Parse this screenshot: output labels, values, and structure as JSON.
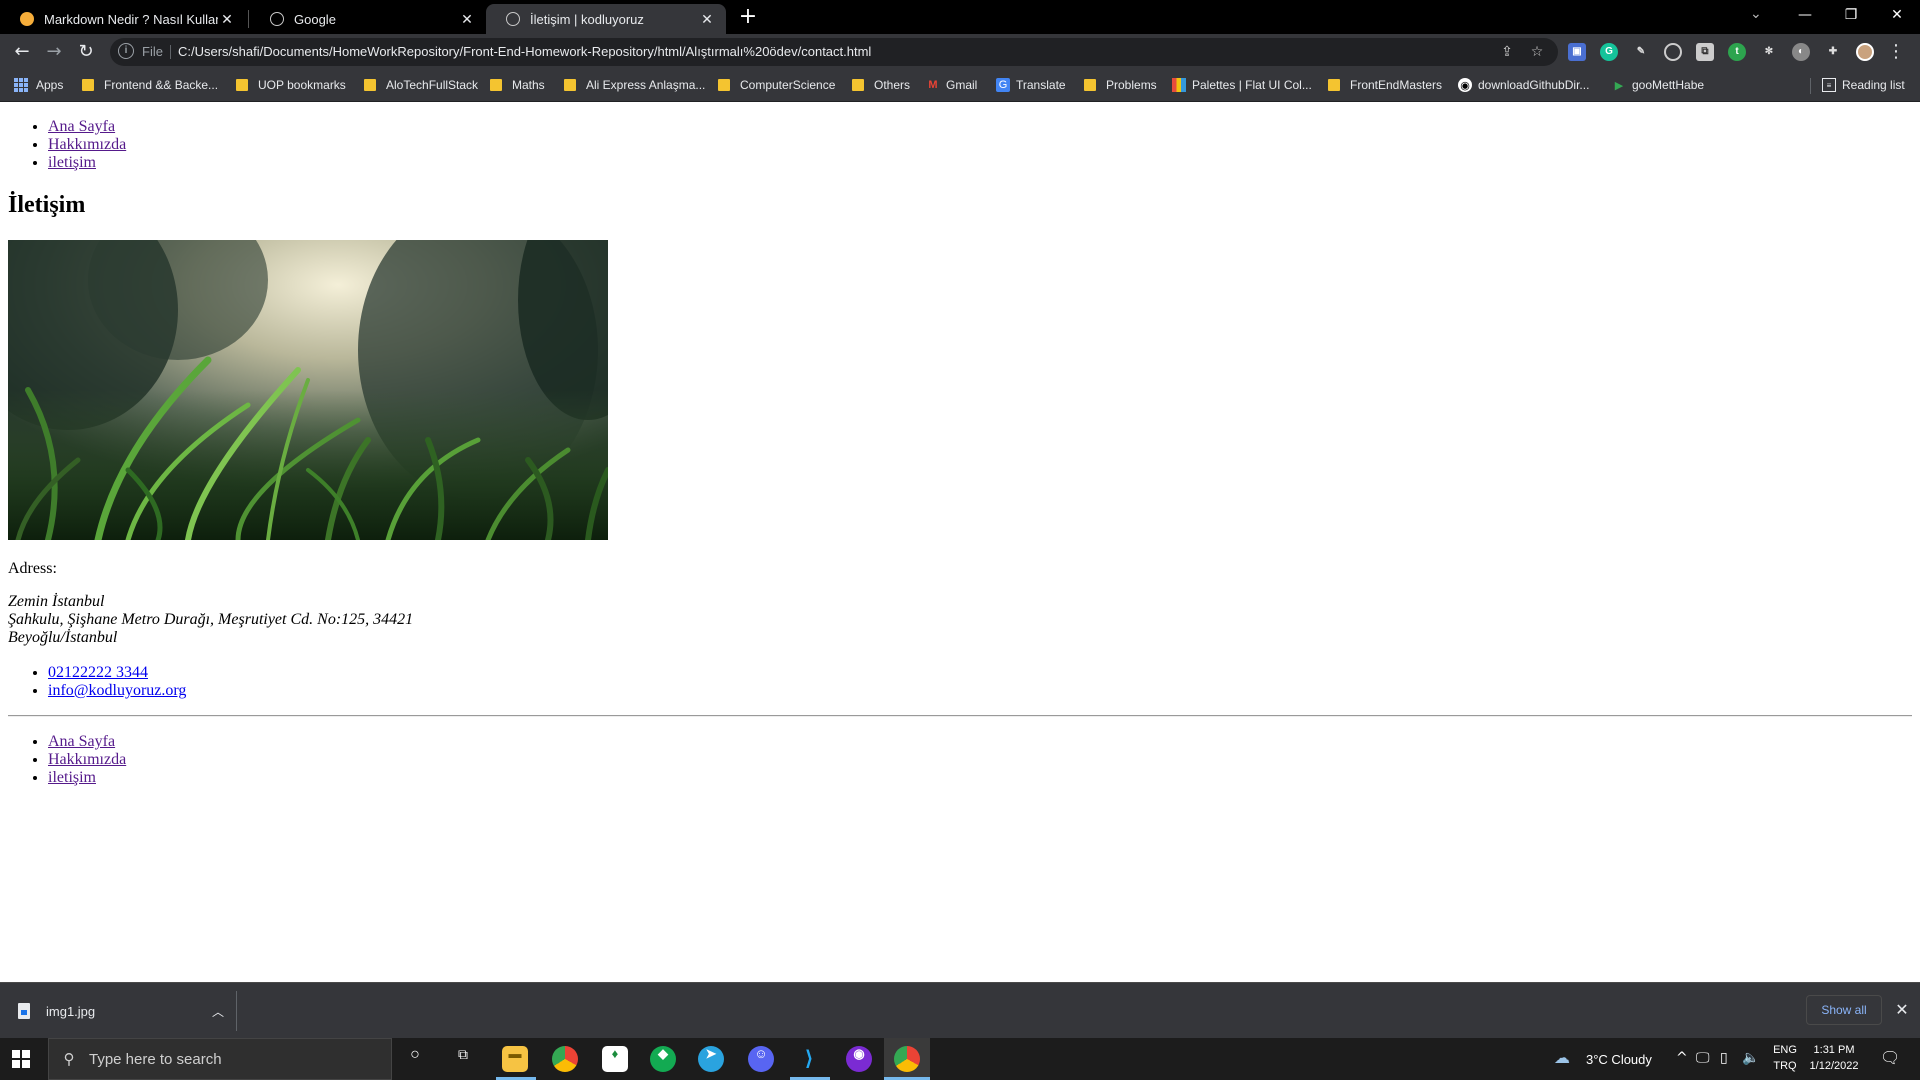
{
  "browser": {
    "tabs": [
      {
        "title": "Markdown Nedir ? Nasıl Kullanılır",
        "icon": "orange-dot-favicon",
        "close": "✕"
      },
      {
        "title": "Google",
        "icon": "globe-favicon",
        "close": "✕"
      },
      {
        "title": "İletişim | kodluyoruz",
        "icon": "globe-favicon",
        "close": "✕",
        "active": true
      }
    ],
    "new_tab": "+",
    "address": {
      "scheme_label": "File",
      "url": "C:/Users/shafi/Documents/HomeWorkRepository/Front-End-Homework-Repository/html/Alıştırmalı%20ödev/contact.html"
    },
    "bookmarks": [
      {
        "label": "Apps",
        "icon": "apps-grid-icon"
      },
      {
        "label": "Frontend && Backe...",
        "icon": "folder-icon"
      },
      {
        "label": "UOP bookmarks",
        "icon": "folder-icon"
      },
      {
        "label": "AloTechFullStack",
        "icon": "folder-icon"
      },
      {
        "label": "Maths",
        "icon": "folder-icon"
      },
      {
        "label": "Ali Express Anlaşma...",
        "icon": "folder-icon"
      },
      {
        "label": "ComputerScience",
        "icon": "folder-icon"
      },
      {
        "label": "Others",
        "icon": "folder-icon"
      },
      {
        "label": "Gmail",
        "icon": "gmail-icon"
      },
      {
        "label": "Translate",
        "icon": "translate-icon"
      },
      {
        "label": "Problems",
        "icon": "folder-icon"
      },
      {
        "label": "Palettes | Flat UI Col...",
        "icon": "palette-icon"
      },
      {
        "label": "FrontEndMasters",
        "icon": "folder-icon"
      },
      {
        "label": "downloadGithubDir...",
        "icon": "github-icon"
      },
      {
        "label": "gooMettHabe",
        "icon": "meet-icon"
      }
    ],
    "reading_list": "Reading list"
  },
  "page": {
    "nav_top": [
      "Ana Sayfa",
      "Hakkımızda",
      "iletişim"
    ],
    "heading": "İletişim",
    "image_alt": "grass photo",
    "adress_label": "Adress:",
    "address_lines": [
      "Zemin İstanbul",
      "Şahkulu, Şişhane Metro Durağı, Meşrutiyet Cd. No:125, 34421",
      "Beyoğlu/İstanbul"
    ],
    "contacts": [
      "02122222 3344",
      "info@kodluyoruz.org"
    ],
    "nav_bottom": [
      "Ana Sayfa",
      "Hakkımızda",
      "iletişim"
    ]
  },
  "download_shelf": {
    "file_name": "img1.jpg",
    "show_all": "Show all",
    "close": "✕"
  },
  "taskbar": {
    "search_placeholder": "Type here to search",
    "weather": "3°C  Cloudy",
    "lang_top": "ENG",
    "lang_bottom": "TRQ",
    "time": "1:31 PM",
    "date": "1/12/2022"
  },
  "colors": {
    "link_visited": "#551a8b",
    "link_unvisited": "#0000ee",
    "chrome_dark": "#35363a",
    "accent_blue": "#8ab4f8"
  }
}
